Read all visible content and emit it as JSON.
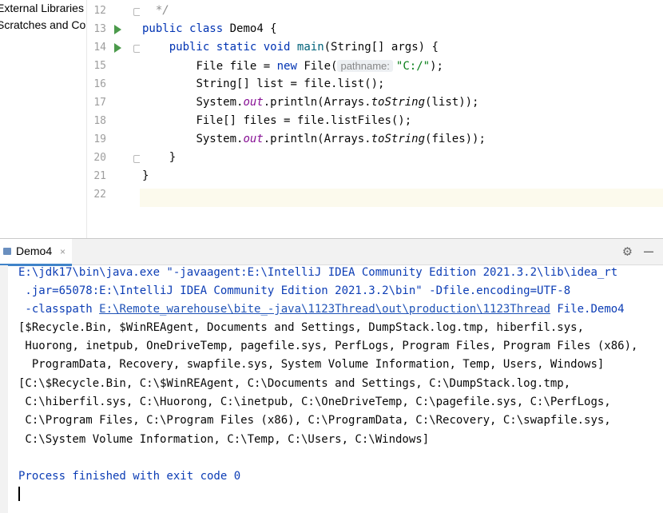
{
  "project": {
    "items": [
      "External Libraries",
      "Scratches and Consoles"
    ]
  },
  "editor": {
    "line_numbers": [
      "12",
      "13",
      "14",
      "15",
      "16",
      "17",
      "18",
      "19",
      "20",
      "21",
      "22"
    ],
    "lines": {
      "l12": {
        "comment": "*/"
      },
      "l13": {
        "kw1": "public",
        "kw2": "class",
        "name": "Demo4 {"
      },
      "l14": {
        "kw1": "public",
        "kw2": "static",
        "kw3": "void",
        "fn": "main",
        "rest": "(String[] args) {"
      },
      "l15": {
        "pre": "File file = ",
        "kw": "new",
        "mid": " File(",
        "hint": "pathname:",
        "str": "\"C:/\"",
        "post": ");"
      },
      "l16": {
        "text": "String[] list = file.list();"
      },
      "l17": {
        "pre": "System.",
        "st": "out",
        "mid": ".println(Arrays.",
        "it": "toString",
        "post": "(list));"
      },
      "l18": {
        "text": "File[] files = file.listFiles();"
      },
      "l19": {
        "pre": "System.",
        "st": "out",
        "mid": ".println(Arrays.",
        "it": "toString",
        "post": "(files));"
      },
      "l20": {
        "text": "}"
      },
      "l21": {
        "text": "}"
      }
    }
  },
  "run_panel": {
    "tab_label": "Demo4",
    "tab_close": "×",
    "settings_icon": "gear-icon",
    "minimize_icon": "minus-icon",
    "output": {
      "cmd1": "E:\\jdk17\\bin\\java.exe \"-javaagent:E:\\IntelliJ IDEA Community Edition 2021.3.2\\lib\\idea_rt",
      "cmd2": " .jar=65078:E:\\IntelliJ IDEA Community Edition 2021.3.2\\bin\" -Dfile.encoding=UTF-8",
      "cmd3_pre": " -classpath ",
      "cmd3_link": "E:\\Remote_warehouse\\bite_-java\\1123Thread\\out\\production\\1123Thread",
      "cmd3_post": " File.Demo4",
      "res1": "[$Recycle.Bin, $WinREAgent, Documents and Settings, DumpStack.log.tmp, hiberfil.sys,",
      "res2": " Huorong, inetpub, OneDriveTemp, pagefile.sys, PerfLogs, Program Files, Program Files (x86),",
      "res3": "  ProgramData, Recovery, swapfile.sys, System Volume Information, Temp, Users, Windows]",
      "res4": "[C:\\$Recycle.Bin, C:\\$WinREAgent, C:\\Documents and Settings, C:\\DumpStack.log.tmp,",
      "res5": " C:\\hiberfil.sys, C:\\Huorong, C:\\inetpub, C:\\OneDriveTemp, C:\\pagefile.sys, C:\\PerfLogs,",
      "res6": " C:\\Program Files, C:\\Program Files (x86), C:\\ProgramData, C:\\Recovery, C:\\swapfile.sys,",
      "res7": " C:\\System Volume Information, C:\\Temp, C:\\Users, C:\\Windows]",
      "exit": "Process finished with exit code 0"
    }
  },
  "colors": {
    "keyword": "#0033b3",
    "string": "#067d17",
    "static_field": "#871094",
    "console_blue": "#0c3db5",
    "run_green": "#4b9a4b"
  }
}
